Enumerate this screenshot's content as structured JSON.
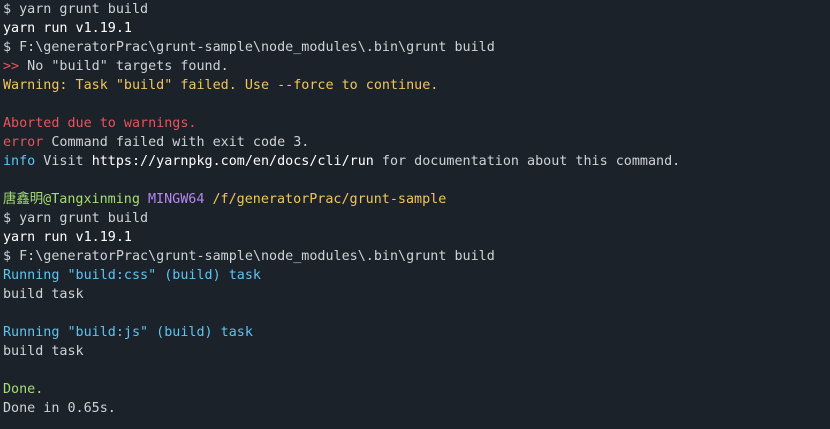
{
  "terminal": {
    "lines": [
      [
        {
          "t": "$ yarn grunt build",
          "c": "default"
        }
      ],
      [
        {
          "t": "yarn run v1.19.1",
          "c": "white"
        }
      ],
      [
        {
          "t": "$ F:\\generatorPrac\\grunt-sample\\node_modules\\.bin\\grunt build",
          "c": "default"
        }
      ],
      [
        {
          "t": ">>",
          "c": "red"
        },
        {
          "t": " No \"build\" targets found.",
          "c": "default"
        }
      ],
      [
        {
          "t": "Warning: Task \"build\" failed. Use --force to continue.",
          "c": "yellow"
        }
      ],
      [],
      [
        {
          "t": "Aborted due to warnings.",
          "c": "red"
        }
      ],
      [
        {
          "t": "error",
          "c": "red"
        },
        {
          "t": " Command failed with exit code 3.",
          "c": "default"
        }
      ],
      [
        {
          "t": "info",
          "c": "blue"
        },
        {
          "t": " Visit ",
          "c": "default"
        },
        {
          "t": "https://yarnpkg.com/en/docs/cli/run",
          "c": "white"
        },
        {
          "t": " for documentation about this command.",
          "c": "default"
        }
      ],
      [],
      [
        {
          "t": "唐鑫明@Tangxinming",
          "c": "green"
        },
        {
          "t": " ",
          "c": "default"
        },
        {
          "t": "MINGW64",
          "c": "purple"
        },
        {
          "t": " ",
          "c": "default"
        },
        {
          "t": "/f/generatorPrac/grunt-sample",
          "c": "yellow"
        }
      ],
      [
        {
          "t": "$ yarn grunt build",
          "c": "default"
        }
      ],
      [
        {
          "t": "yarn run v1.19.1",
          "c": "white"
        }
      ],
      [
        {
          "t": "$ F:\\generatorPrac\\grunt-sample\\node_modules\\.bin\\grunt build",
          "c": "default"
        }
      ],
      [
        {
          "t": "Running \"build:css\" (build) task",
          "c": "blue"
        }
      ],
      [
        {
          "t": "build task",
          "c": "default"
        }
      ],
      [],
      [
        {
          "t": "Running \"build:js\" (build) task",
          "c": "blue"
        }
      ],
      [
        {
          "t": "build task",
          "c": "default"
        }
      ],
      [],
      [
        {
          "t": "Done.",
          "c": "green"
        }
      ],
      [
        {
          "t": "Done in 0.65s.",
          "c": "default"
        }
      ]
    ]
  }
}
